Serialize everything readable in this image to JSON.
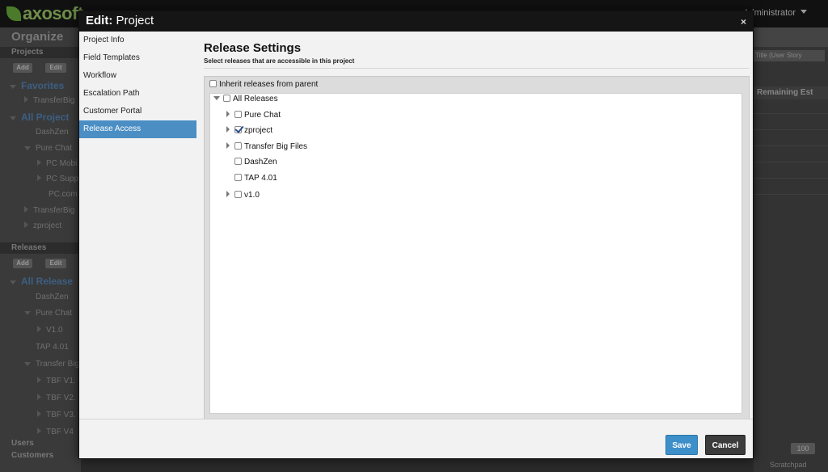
{
  "app": {
    "logo_text": "axosoft",
    "user_label": "Administrator",
    "organize_label": "Organize",
    "projects_section": "Projects",
    "add_label": "Add",
    "edit_label": "Edit",
    "favorites": "Favorites",
    "favorites_child": "TransferBig",
    "all_projects": "All Project",
    "project_items": [
      "DashZen",
      "Pure Chat",
      "PC Mobi",
      "PC Supp",
      "PC.com",
      "TransferBig",
      "zproject"
    ],
    "releases_section": "Releases",
    "all_releases": "All Release",
    "release_items": [
      "DashZen",
      "Pure Chat",
      "V1.0",
      "TAP 4.01",
      "Transfer Big",
      "TBF V1.",
      "TBF V2.",
      "TBF V3.",
      "TBF V4"
    ],
    "users_label": "Users",
    "customers_label": "Customers",
    "filter_text": "Title (User Story",
    "remaining_col": "Remaining Est",
    "page_size": "100",
    "scratchpad": "Scratchpad"
  },
  "modal": {
    "title_prefix": "Edit:",
    "title_name": "Project",
    "close": "×",
    "nav": [
      {
        "label": "Project Info",
        "active": false
      },
      {
        "label": "Field Templates",
        "active": false
      },
      {
        "label": "Workflow",
        "active": false
      },
      {
        "label": "Escalation Path",
        "active": false
      },
      {
        "label": "Customer Portal",
        "active": false
      },
      {
        "label": "Release Access",
        "active": true
      }
    ],
    "heading": "Release Settings",
    "subheading": "Select releases that are accessible in this project",
    "inherit_label": "Inherit releases from parent",
    "inherit_checked": false,
    "root": {
      "label": "All Releases",
      "checked": false,
      "expanded": true
    },
    "releases": [
      {
        "label": "Pure Chat",
        "checked": false,
        "expandable": true
      },
      {
        "label": "zproject",
        "checked": true,
        "expandable": true
      },
      {
        "label": "Transfer Big Files",
        "checked": false,
        "expandable": true
      },
      {
        "label": "DashZen",
        "checked": false,
        "expandable": false
      },
      {
        "label": "TAP 4.01",
        "checked": false,
        "expandable": false
      },
      {
        "label": "v1.0",
        "checked": false,
        "expandable": true
      }
    ],
    "save_label": "Save",
    "cancel_label": "Cancel"
  },
  "colors": {
    "accent": "#4a8ec4",
    "save": "#3d8fc9",
    "cancel": "#3c3c3c",
    "header": "#151515"
  }
}
